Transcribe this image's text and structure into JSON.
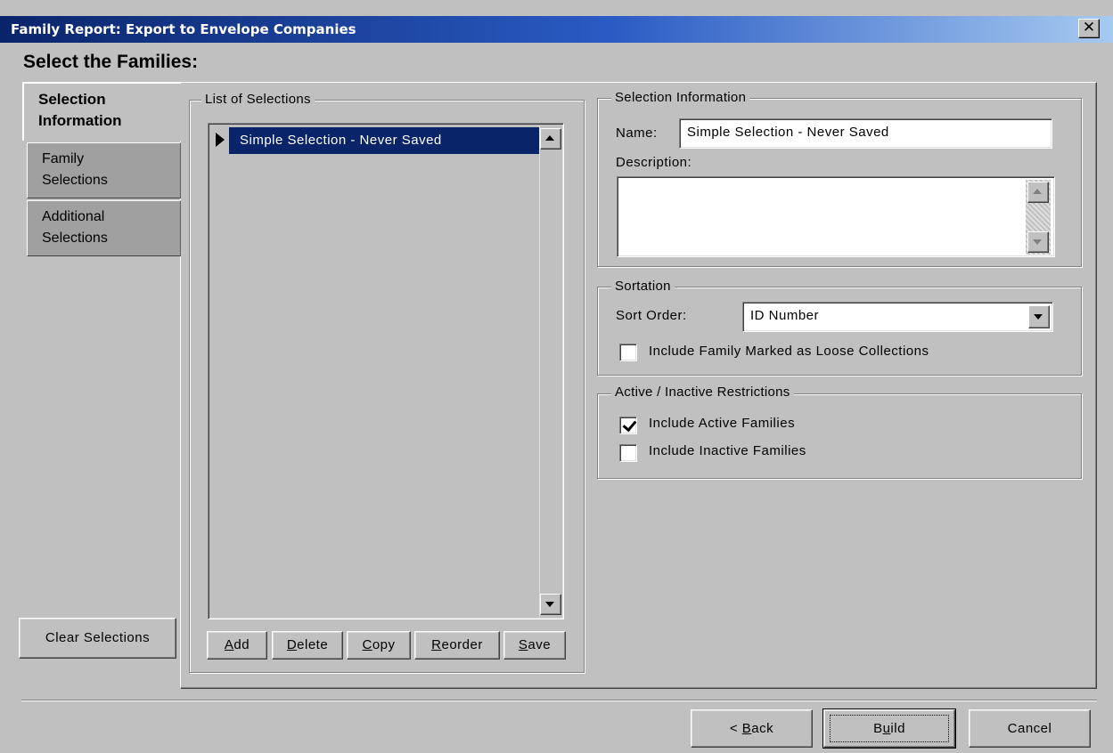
{
  "window": {
    "title": "Family Report:  Export to Envelope Companies",
    "close_glyph": "✕"
  },
  "heading": "Select the Families:",
  "tabs": [
    {
      "label_line1": "Selection",
      "label_line2": "Information",
      "active": true
    },
    {
      "label_line1": "Family",
      "label_line2": "Selections",
      "active": false
    },
    {
      "label_line1": "Additional",
      "label_line2": "Selections",
      "active": false
    }
  ],
  "clear_selections_label": "Clear Selections",
  "list_of_selections": {
    "legend": "List of Selections",
    "items": [
      "Simple Selection - Never Saved"
    ],
    "buttons": {
      "add": {
        "pre": "",
        "key": "A",
        "post": "dd"
      },
      "delete": {
        "pre": "",
        "key": "D",
        "post": "elete"
      },
      "copy": {
        "pre": "",
        "key": "C",
        "post": "opy"
      },
      "reorder": {
        "pre": "",
        "key": "R",
        "post": "eorder"
      },
      "save": {
        "pre": "",
        "key": "S",
        "post": "ave"
      }
    }
  },
  "selection_information": {
    "legend": "Selection Information",
    "name_label": "Name:",
    "name_value": "Simple Selection - Never Saved",
    "description_label": "Description:",
    "description_value": ""
  },
  "sortation": {
    "legend": "Sortation",
    "sort_order_label": "Sort Order:",
    "sort_order_value": "ID Number",
    "include_loose_label": "Include Family Marked as Loose Collections",
    "include_loose_checked": false
  },
  "restrictions": {
    "legend": "Active / Inactive Restrictions",
    "include_active_label": "Include Active Families",
    "include_active_checked": true,
    "include_inactive_label": "Include Inactive Families",
    "include_inactive_checked": false
  },
  "footer": {
    "back": {
      "pre": "< ",
      "key": "B",
      "post": "ack"
    },
    "build": {
      "pre": "B",
      "key": "u",
      "post": "ild"
    },
    "cancel": "Cancel"
  },
  "colors": {
    "face": "#c0c0c0",
    "titlebar_start": "#0a246a",
    "titlebar_end": "#a6caf0",
    "highlight": "#0a246a"
  }
}
